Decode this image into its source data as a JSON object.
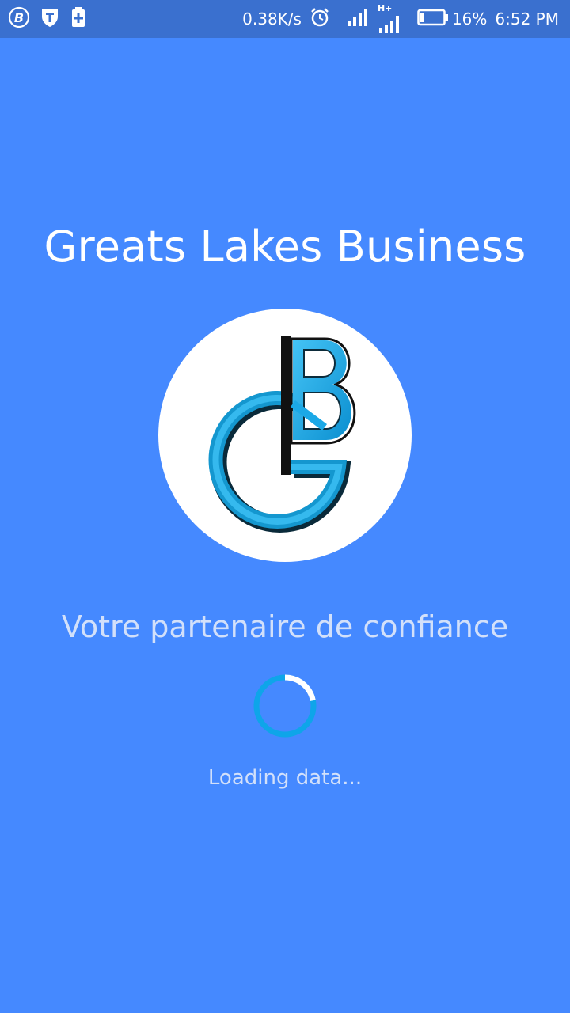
{
  "status_bar": {
    "network_speed": "0.38K/s",
    "network_type": "H+",
    "battery_percent": "16%",
    "time": "6:52 PM",
    "icons": [
      "b-app-icon",
      "shield-icon",
      "battery-saver-icon",
      "alarm-icon",
      "signal-icon",
      "signal-hplus-icon",
      "battery-icon"
    ]
  },
  "splash": {
    "title": "Greats Lakes Business",
    "tagline": "Votre partenaire de confiance",
    "loading_text": "Loading data...",
    "logo_text": "GLB",
    "loading_progress": 0.22
  },
  "colors": {
    "background": "#4589FF",
    "status_bar": "#3A70CF",
    "logo_blue": "#1BA8E6",
    "spinner_track": "#0EA5E9",
    "spinner_highlight": "#FFFFFF"
  }
}
